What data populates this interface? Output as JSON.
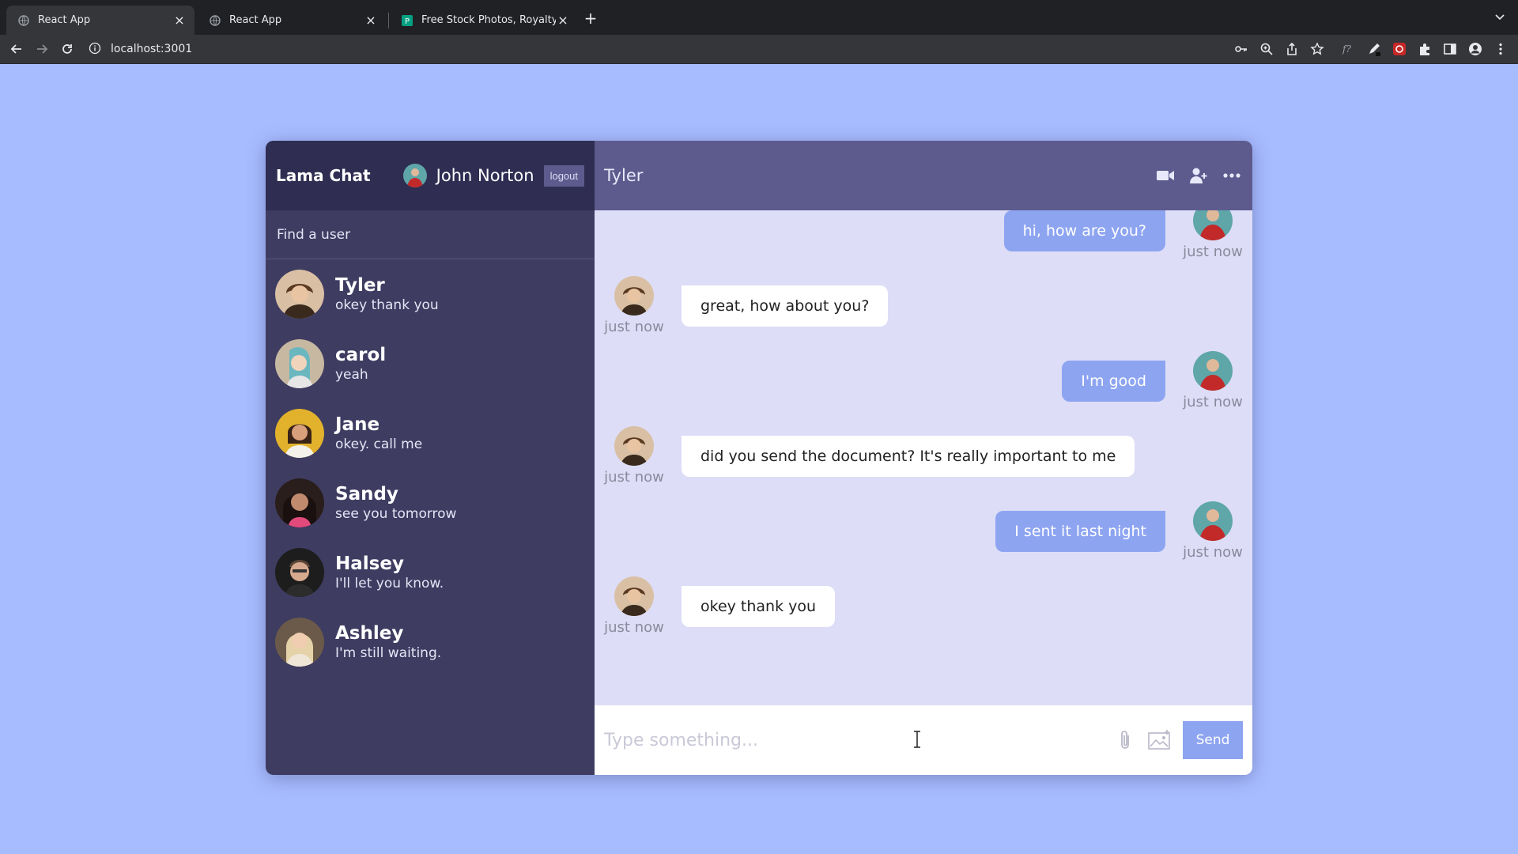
{
  "browser": {
    "tabs": [
      {
        "title": "React App",
        "active": true
      },
      {
        "title": "React App",
        "active": false
      },
      {
        "title": "Free Stock Photos, Royalty Fre",
        "active": false
      }
    ],
    "url": "localhost:3001"
  },
  "app": {
    "logo": "Lama Chat",
    "current_user": {
      "name": "John Norton"
    },
    "logout_label": "logout",
    "search_placeholder": "Find a user",
    "chats": [
      {
        "name": "Tyler",
        "last_message": "okey thank you",
        "avatar_color": "#9a6b45"
      },
      {
        "name": "carol",
        "last_message": "yeah",
        "avatar_color": "#c9a98a"
      },
      {
        "name": "Jane",
        "last_message": "okey. call me",
        "avatar_color": "#e2b22c"
      },
      {
        "name": "Sandy",
        "last_message": "see you tomorrow",
        "avatar_color": "#5a3a36"
      },
      {
        "name": "Halsey",
        "last_message": "I'll let you know.",
        "avatar_color": "#c0b5ad"
      },
      {
        "name": "Ashley",
        "last_message": "I'm still waiting.",
        "avatar_color": "#d9c2a4"
      }
    ],
    "active_chat": {
      "name": "Tyler",
      "messages": [
        {
          "text": "hi, how are you?",
          "time": "just now",
          "owner": true
        },
        {
          "text": "great, how about you?",
          "time": "just now",
          "owner": false
        },
        {
          "text": "I'm good",
          "time": "just now",
          "owner": true
        },
        {
          "text": "did you send the document? It's really important to me",
          "time": "just now",
          "owner": false
        },
        {
          "text": "I sent it last night",
          "time": "just now",
          "owner": true
        },
        {
          "text": "okey thank you",
          "time": "just now",
          "owner": false
        }
      ]
    },
    "input_placeholder": "Type something...",
    "send_label": "Send"
  },
  "colors": {
    "page_bg": "#a7bcff",
    "sidebar_bg": "#3e3c61",
    "sidebar_nav_bg": "#2f2d52",
    "chat_header_bg": "#5d5b8d",
    "messages_bg": "#ddddf7",
    "owner_bubble": "#8da4f1",
    "send_button": "#8da4f1"
  },
  "icons": [
    "video-camera-icon",
    "add-user-icon",
    "more-icon",
    "attach-icon",
    "image-icon"
  ]
}
